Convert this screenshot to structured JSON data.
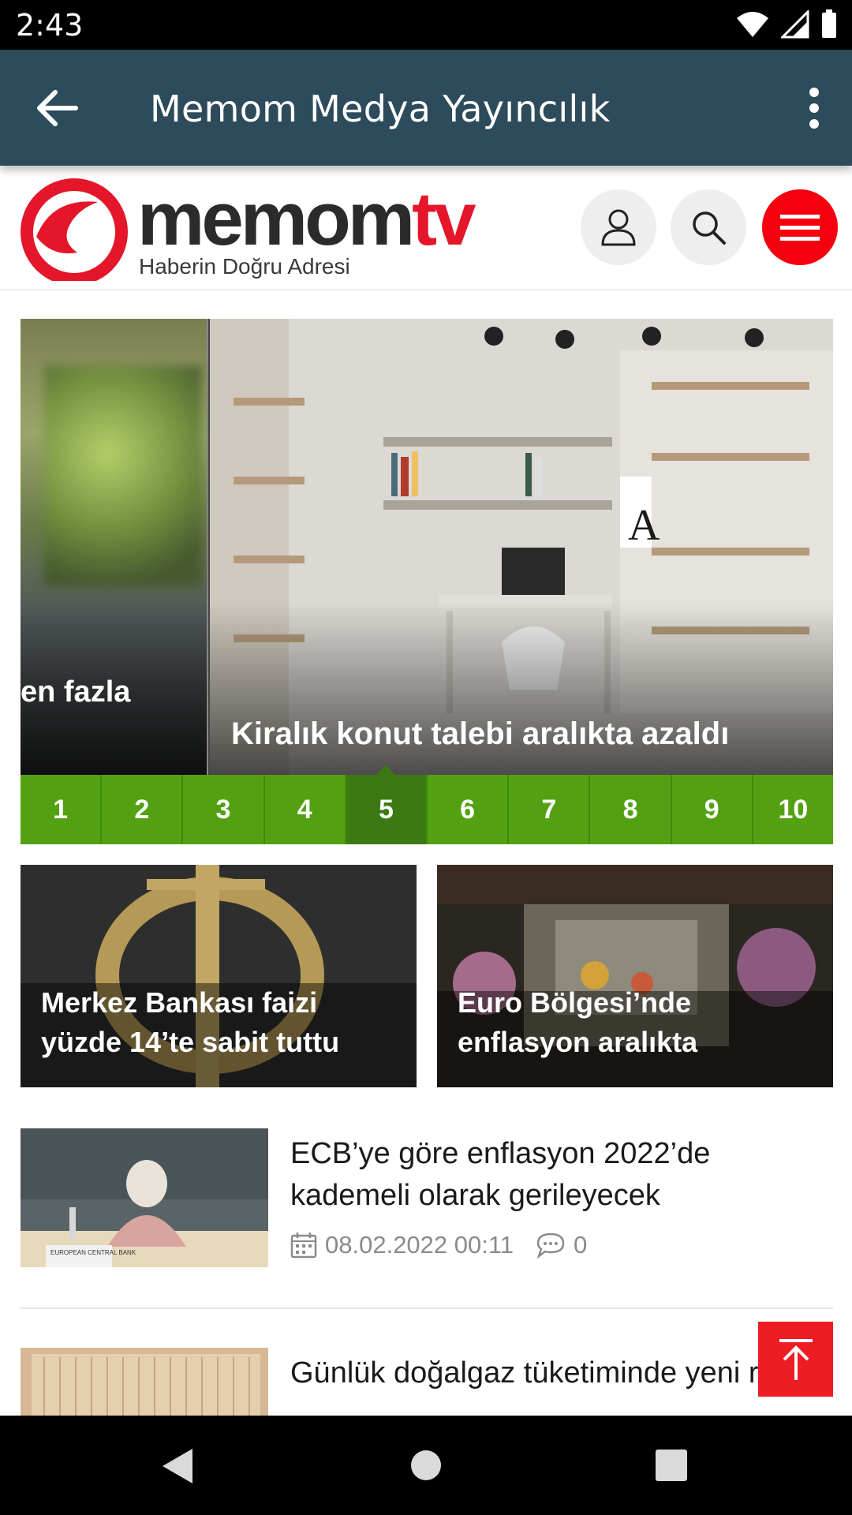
{
  "status_bar": {
    "time": "2:43"
  },
  "app_bar": {
    "title": "Memom Medya Yayıncılık"
  },
  "site_header": {
    "logo_main": "memom",
    "logo_accent": "tv",
    "tagline": "Haberin Doğru Adresi"
  },
  "slider": {
    "prev_caption": "en fazla",
    "caption": "Kiralık konut talebi aralıkta azaldı",
    "pages": [
      "1",
      "2",
      "3",
      "4",
      "5",
      "6",
      "7",
      "8",
      "9",
      "10"
    ],
    "active_page": 5
  },
  "cards": [
    {
      "title": "Merkez Bankası faizi yüzde 14’te sabit tuttu"
    },
    {
      "title": "Euro Bölgesi’nde enflasyon aralıkta"
    }
  ],
  "list": [
    {
      "title": "ECB’ye göre enflasyon 2022’de kademeli olarak gerileyecek",
      "date": "08.02.2022 00:11",
      "comments": "0"
    },
    {
      "title": "Günlük doğalgaz tüketiminde yeni rekor"
    }
  ],
  "thumb_labels": {
    "ecb_sign": "EUROPEAN CENTRAL BANK"
  },
  "colors": {
    "app_bar": "#2d4b5b",
    "accent_red": "#f4000f",
    "pager_green": "#53a113",
    "pager_active": "#3b7a12"
  }
}
